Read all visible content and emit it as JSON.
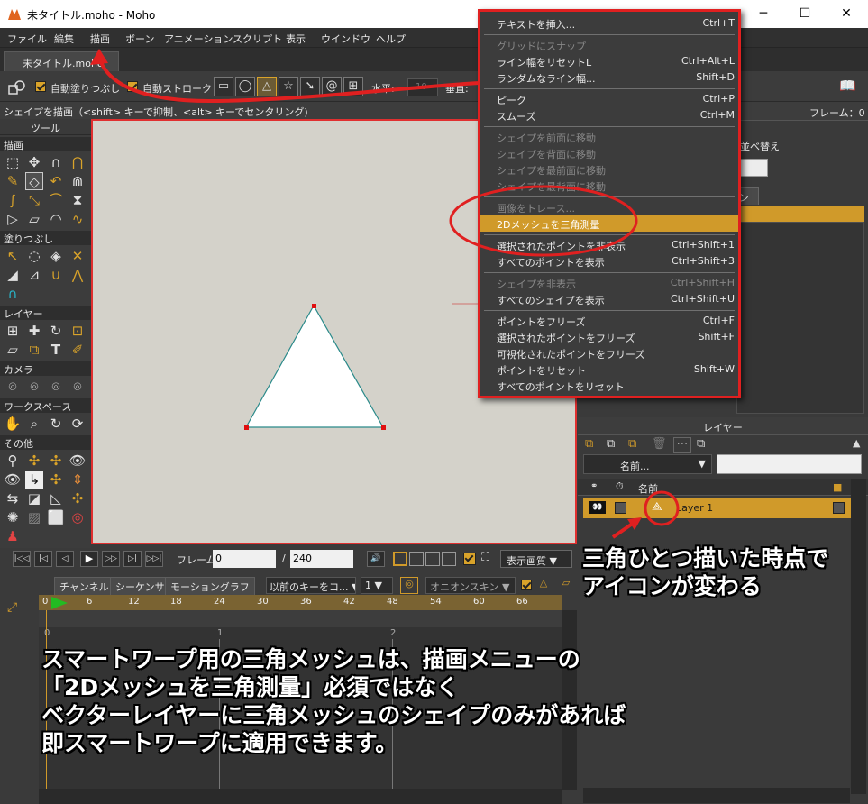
{
  "window": {
    "title": "未タイトル.moho - Moho",
    "minimize": "─",
    "maximize": "☐",
    "close": "✕"
  },
  "menubar": [
    "ファイル",
    "編集",
    "描画",
    "ボーン",
    "アニメーション",
    "スクリプト",
    "表示",
    "ウインドウ",
    "ヘルプ"
  ],
  "doc_tab": "未タイトル.moho",
  "tool_options": {
    "auto_fill": "自動塗りつぶし",
    "auto_stroke": "自動ストローク",
    "horizontal_label": "水平:",
    "horizontal_value": "10",
    "vertical_label": "垂直:"
  },
  "status": "シェイプを描画（<shift> キーで抑制、<alt> キーでセンタリング)",
  "tools_panel": {
    "header": "ツール",
    "sections": [
      "描画",
      "塗りつぶし",
      "レイヤー",
      "カメラ",
      "ワークスペース",
      "その他"
    ]
  },
  "right_panel": {
    "frame_label": "フレーム：0",
    "sort_label": "並べ替え",
    "tab_fragment": "ン"
  },
  "draw_menu": {
    "items": [
      {
        "label": "テキストを挿入...",
        "shortcut": "Ctrl+T",
        "enabled": true
      },
      {
        "label": "グリッドにスナップ",
        "shortcut": "",
        "enabled": false
      },
      {
        "label": "ライン幅をリセットL",
        "shortcut": "Ctrl+Alt+L",
        "enabled": true
      },
      {
        "label": "ランダムなライン幅...",
        "shortcut": "Shift+D",
        "enabled": true
      },
      {
        "label": "ピーク",
        "shortcut": "Ctrl+P",
        "enabled": true
      },
      {
        "label": "スムーズ",
        "shortcut": "Ctrl+M",
        "enabled": true
      },
      {
        "label": "シェイプを前面に移動",
        "shortcut": "",
        "enabled": false
      },
      {
        "label": "シェイプを背面に移動",
        "shortcut": "",
        "enabled": false
      },
      {
        "label": "シェイプを最前面に移動",
        "shortcut": "",
        "enabled": false
      },
      {
        "label": "シェイプを最背面に移動",
        "shortcut": "",
        "enabled": false
      },
      {
        "label": "画像をトレース...",
        "shortcut": "",
        "enabled": false
      },
      {
        "label": "2Dメッシュを三角測量",
        "shortcut": "",
        "enabled": true
      },
      {
        "label": "選択されたポイントを非表示",
        "shortcut": "Ctrl+Shift+1",
        "enabled": true
      },
      {
        "label": "すべてのポイントを表示",
        "shortcut": "Ctrl+Shift+3",
        "enabled": true
      },
      {
        "label": "シェイプを非表示",
        "shortcut": "Ctrl+Shift+H",
        "enabled": false
      },
      {
        "label": "すべてのシェイプを表示",
        "shortcut": "Ctrl+Shift+U",
        "enabled": true
      },
      {
        "label": "ポイントをフリーズ",
        "shortcut": "Ctrl+F",
        "enabled": true
      },
      {
        "label": "選択されたポイントをフリーズ",
        "shortcut": "Shift+F",
        "enabled": true
      },
      {
        "label": "可視化されたポイントをフリーズ",
        "shortcut": "",
        "enabled": true
      },
      {
        "label": "ポイントをリセット",
        "shortcut": "Shift+W",
        "enabled": true
      },
      {
        "label": "すべてのポイントをリセット",
        "shortcut": "",
        "enabled": true
      }
    ],
    "highlighted_index": 11
  },
  "playback": {
    "frame_label": "フレーム",
    "frame_value": "0",
    "end_frame": "240",
    "separator": "/",
    "quality": "表示画質"
  },
  "timeline": {
    "tabs": [
      "チャンネル",
      "シーケンサ",
      "モーショングラフ"
    ],
    "key_dropdown": "以前のキーをコ...",
    "num_dropdown": "1",
    "onion": "オニオンスキン",
    "ruler_ticks": [
      "0",
      "6",
      "12",
      "18",
      "24",
      "30",
      "36",
      "42",
      "48",
      "54",
      "60",
      "66"
    ],
    "track_marks": [
      "0",
      "1",
      "2"
    ]
  },
  "layers_panel": {
    "header": "レイヤー",
    "name_dropdown": "名前...",
    "column_name": "名前",
    "layer_name": "Layer 1"
  },
  "annotations": {
    "side": [
      "三角ひとつ描いた時点で",
      "アイコンが変わる"
    ],
    "main": [
      "スマートワープ用の三角メッシュは、描画メニューの",
      "「2Dメッシュを三角測量」必須ではなく",
      "ベクターレイヤーに三角メッシュのシェイプのみがあれば",
      "即スマートワープに適用できます。"
    ]
  },
  "colors": {
    "accent": "#d09a2a",
    "annotation_red": "#e02020",
    "canvas_bg": "#d4d2ca"
  }
}
